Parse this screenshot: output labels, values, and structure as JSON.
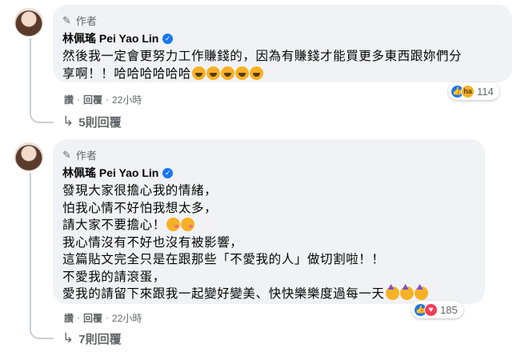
{
  "comments": [
    {
      "author_badge": "作者",
      "name": "林佩瑤 Pei Yao Lin",
      "lines": [
        "然後我一定會更努力工作賺錢的，因為有賺錢才能買更多東西跟妳們分",
        "享啊！！哈哈哈哈哈哈"
      ],
      "line_emojis": [
        [],
        [
          "rofl-emoji",
          "rofl-emoji",
          "rofl-emoji",
          "rofl-emoji",
          "rofl-emoji"
        ]
      ],
      "reaction_icons": [
        "like-icon",
        "haha-icon"
      ],
      "reaction_count": "114",
      "actions": {
        "like": "讚",
        "reply": "回覆",
        "time": "22小時"
      },
      "replies_label": "5則回覆"
    },
    {
      "author_badge": "作者",
      "name": "林佩瑤 Pei Yao Lin",
      "lines": [
        "發現大家很擔心我的情緒，",
        "怕我心情不好怕我想太多，",
        "請大家不要擔心！",
        "我心情沒有不好也沒有被影響，",
        "這篇貼文完全只是在跟那些「不愛我的人」做切割啦！！",
        "不愛我的請滾蛋，",
        "愛我的請留下來跟我一起變好變美、快快樂樂度過每一天"
      ],
      "line_emojis": [
        [],
        [],
        [
          "kiss-emoji",
          "kiss-emoji"
        ],
        [],
        [],
        [],
        [
          "party-emoji",
          "party-emoji",
          "party-emoji"
        ]
      ],
      "reaction_icons": [
        "like-icon",
        "love-icon"
      ],
      "reaction_count": "185",
      "actions": {
        "like": "讚",
        "reply": "回覆",
        "time": "22小時"
      },
      "replies_label": "7則回覆"
    }
  ],
  "colors": {
    "bubble": "#f0f2f5",
    "secondary_text": "#65676b",
    "verified": "#1877f2",
    "like": "#1877f2",
    "love": "#f33e58",
    "haha": "#f7b125"
  }
}
